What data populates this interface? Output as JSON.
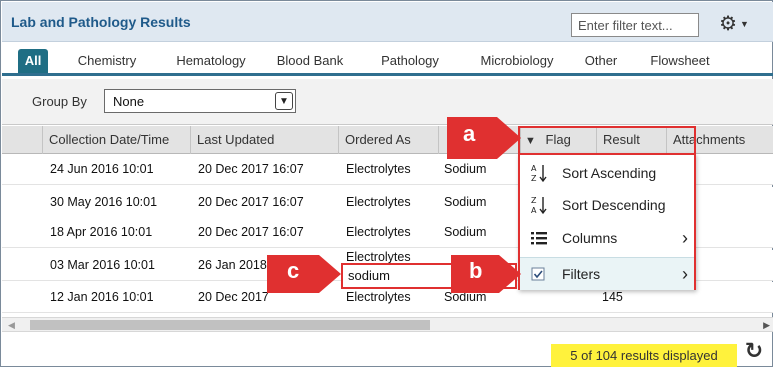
{
  "panel": {
    "title": "Lab and Pathology Results",
    "filter_placeholder": "Enter filter text...",
    "gear_icon": "gear-icon"
  },
  "tabs": [
    {
      "label": "All",
      "active": true
    },
    {
      "label": "Chemistry"
    },
    {
      "label": "Hematology"
    },
    {
      "label": "Blood Bank"
    },
    {
      "label": "Pathology"
    },
    {
      "label": "Microbiology"
    },
    {
      "label": "Other"
    },
    {
      "label": "Flowsheet"
    }
  ],
  "groupby": {
    "label": "Group By",
    "value": "None"
  },
  "columns": [
    "Collection Date/Time",
    "Last Updated",
    "Ordered As",
    "Flag",
    "Result",
    "Attachments"
  ],
  "rows": [
    {
      "collected": "24 Jun 2016 10:01",
      "updated": "20 Dec 2017 16:07",
      "ordered": "Electrolytes",
      "name": "Sodium"
    },
    {
      "collected": "30 May 2016 10:01",
      "updated": "20 Dec 2017 16:07",
      "ordered": "Electrolytes",
      "name": "Sodium"
    },
    {
      "collected": "18 Apr 2016 10:01",
      "updated": "20 Dec 2017 16:07",
      "ordered": "Electrolytes",
      "name": "Sodium"
    },
    {
      "collected": "03 Mar 2016 10:01",
      "updated": "26 Jan 2018",
      "ordered": "Electrolytes",
      "name": ""
    },
    {
      "collected": "12 Jan 2016 10:01",
      "updated": "20 Dec 2017",
      "ordered": "Electrolytes",
      "name": "Sodium",
      "result": "145"
    }
  ],
  "column_menu": {
    "items": [
      {
        "label": "Sort Ascending",
        "icon": "sort-ascending-icon",
        "glyph": "A↓Z"
      },
      {
        "label": "Sort Descending",
        "icon": "sort-descending-icon",
        "glyph": "Z↓A"
      },
      {
        "label": "Columns",
        "icon": "columns-icon",
        "glyph": "☰",
        "submenu": true
      },
      {
        "label": "Filters",
        "icon": "checkbox-icon",
        "glyph": "☑",
        "submenu": true,
        "checked": true
      }
    ]
  },
  "filter_value": "sodium",
  "status": "5 of 104 results displayed",
  "callouts": {
    "a": "a",
    "b": "b",
    "c": "c"
  },
  "colors": {
    "accent": "#1f6e84",
    "callout": "#e03030",
    "status_bg": "#fff23c",
    "title": "#1f5a8a"
  }
}
